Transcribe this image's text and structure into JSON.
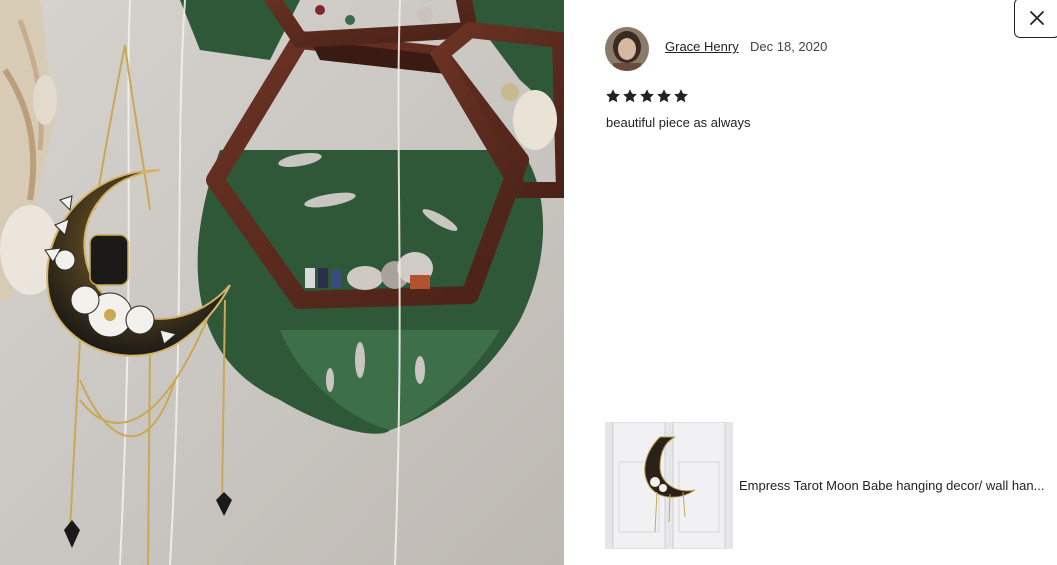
{
  "review": {
    "reviewer_name": "Grace Henry",
    "date": "Dec 18, 2020",
    "rating": 5,
    "rating_max": 5,
    "text": "beautiful piece as always"
  },
  "item": {
    "title": "Empress Tarot Moon Babe hanging decor/ wall han..."
  },
  "icons": {
    "close": "close-icon",
    "star": "star-icon"
  },
  "colors": {
    "star": "#222222",
    "text": "#222222",
    "leaf": "#2f5b3a",
    "wood": "#5a2a1c"
  }
}
